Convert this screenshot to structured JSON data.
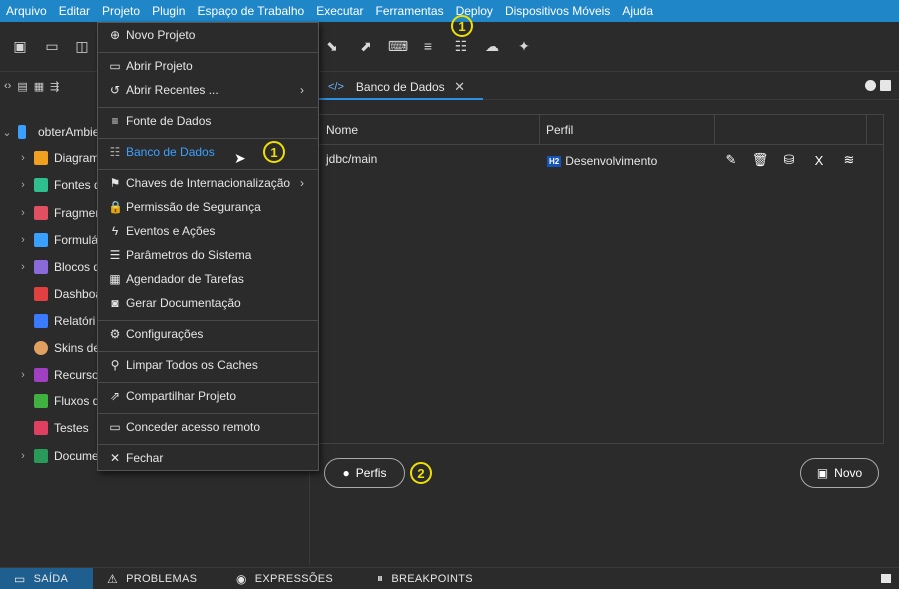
{
  "menubar": {
    "items": [
      "Arquivo",
      "Editar",
      "Projeto",
      "Plugin",
      "Espaço de Trabalho",
      "Executar",
      "Ferramentas",
      "Deploy",
      "Dispositivos Móveis",
      "Ajuda"
    ]
  },
  "markers": {
    "one": "1",
    "two": "2"
  },
  "tree": {
    "root": "obterAmbie",
    "items": [
      "Diagram",
      "Fontes d",
      "Fragmer",
      "Formulá",
      "Blocos d",
      "Dashboa",
      "Relatóri",
      "Skins de",
      "Recurso",
      "Fluxos d",
      "Testes",
      "Docume"
    ]
  },
  "tab": {
    "label": "Banco de Dados",
    "code_icon": "</>",
    "close": "✕"
  },
  "grid": {
    "headers": {
      "name": "Nome",
      "profile": "Perfil"
    },
    "rows": [
      {
        "name": "jdbc/main",
        "badge": "H2",
        "profile": "Desenvolvimento"
      }
    ]
  },
  "buttons": {
    "profiles": "Perfis",
    "new": "Novo"
  },
  "dropdown": {
    "items": [
      {
        "label": "Novo Projeto",
        "icon": "new-project-icon"
      },
      {
        "label": "Abrir Projeto",
        "icon": "folder-icon"
      },
      {
        "label": "Abrir Recentes ...",
        "icon": "history-icon",
        "submenu": true
      },
      {
        "label": "Fonte de Dados",
        "icon": "datasource-icon"
      },
      {
        "label": "Banco de Dados",
        "icon": "database-icon",
        "highlighted": true
      },
      {
        "label": "Chaves de Internacionalização",
        "icon": "translate-icon",
        "submenu": true
      },
      {
        "label": "Permissão de Segurança",
        "icon": "lock-icon"
      },
      {
        "label": "Eventos e Ações",
        "icon": "bolt-icon"
      },
      {
        "label": "Parâmetros do Sistema",
        "icon": "sliders-icon"
      },
      {
        "label": "Agendador de Tarefas",
        "icon": "calendar-icon"
      },
      {
        "label": "Gerar Documentação",
        "icon": "docs-icon"
      },
      {
        "label": "Configurações",
        "icon": "gear-icon"
      },
      {
        "label": "Limpar Todos os Caches",
        "icon": "broom-icon"
      },
      {
        "label": "Compartilhar Projeto",
        "icon": "share-icon"
      },
      {
        "label": "Conceder acesso remoto",
        "icon": "remote-icon"
      },
      {
        "label": "Fechar",
        "icon": "close-icon"
      }
    ]
  },
  "statusbar": {
    "items": [
      "SAÍDA",
      "PROBLEMAS",
      "EXPRESSÕES",
      "BREAKPOINTS"
    ]
  }
}
